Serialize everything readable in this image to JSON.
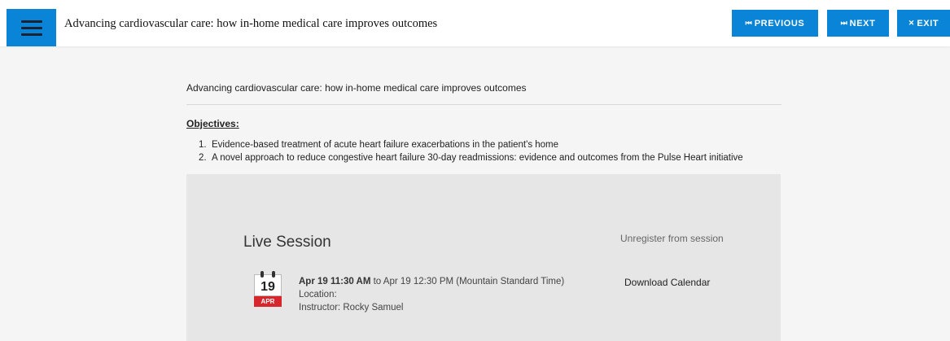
{
  "header": {
    "title": "Advancing cardiovascular care: how in-home medical care improves outcomes",
    "menu_icon": "hamburger-menu-icon",
    "previous": {
      "icon": "⏮",
      "label": "PREVIOUS"
    },
    "next": {
      "icon": "⏭",
      "label": "NEXT"
    },
    "exit": {
      "icon": "✕",
      "label": "EXIT"
    },
    "accent_color": "#0a84d6"
  },
  "main": {
    "title": "Advancing cardiovascular care: how in-home medical care improves outcomes",
    "objectives_heading": "Objectives:",
    "objectives": [
      {
        "num": "1.",
        "text": "Evidence-based treatment of acute heart failure exacerbations in the patient's home"
      },
      {
        "num": "2.",
        "text": "A novel approach to reduce congestive heart failure 30-day readmissions: evidence and outcomes from the Pulse Heart initiative"
      }
    ]
  },
  "session": {
    "title": "Live Session",
    "unregister_label": "Unregister from session",
    "calendar": {
      "day": "19",
      "month": "APR",
      "icon": "calendar-icon",
      "month_color": "#d7262c"
    },
    "start": "Apr 19 11:30 AM",
    "end_text": " to Apr 19 12:30 PM (Mountain Standard Time)",
    "location": "Location:",
    "instructor": "Instructor: Rocky Samuel",
    "download_label": "Download Calendar"
  }
}
